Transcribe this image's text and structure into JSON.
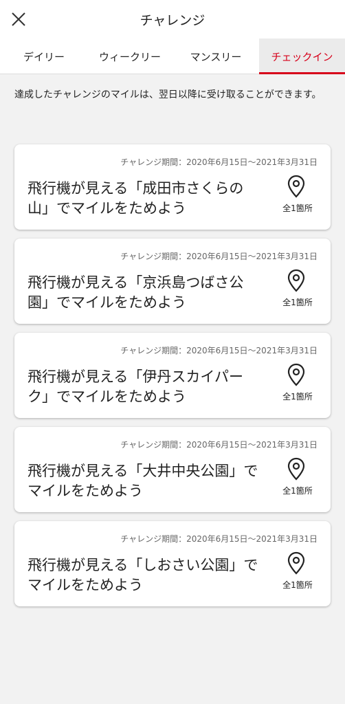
{
  "header": {
    "title": "チャレンジ"
  },
  "tabs": [
    {
      "label": "デイリー"
    },
    {
      "label": "ウィークリー"
    },
    {
      "label": "マンスリー"
    },
    {
      "label": "チェックイン"
    }
  ],
  "active_tab_index": 3,
  "accent_color": "#d7001a",
  "notice": "達成したチャレンジのマイルは、翌日以降に受け取ることができます。",
  "challenges": [
    {
      "period": "チャレンジ期間：2020年6月15日～2021年3月31日",
      "title": "飛行機が見える「成田市さくらの山」でマイルをためよう",
      "count": "全1箇所",
      "icon": "location-pin-icon"
    },
    {
      "period": "チャレンジ期間：2020年6月15日～2021年3月31日",
      "title": "飛行機が見える「京浜島つばさ公園」でマイルをためよう",
      "count": "全1箇所",
      "icon": "location-pin-icon"
    },
    {
      "period": "チャレンジ期間：2020年6月15日～2021年3月31日",
      "title": "飛行機が見える「伊丹スカイパーク」でマイルをためよう",
      "count": "全1箇所",
      "icon": "location-pin-icon"
    },
    {
      "period": "チャレンジ期間：2020年6月15日～2021年3月31日",
      "title": "飛行機が見える「大井中央公園」でマイルをためよう",
      "count": "全1箇所",
      "icon": "location-pin-icon"
    },
    {
      "period": "チャレンジ期間：2020年6月15日～2021年3月31日",
      "title": "飛行機が見える「しおさい公園」でマイルをためよう",
      "count": "全1箇所",
      "icon": "location-pin-icon"
    }
  ]
}
